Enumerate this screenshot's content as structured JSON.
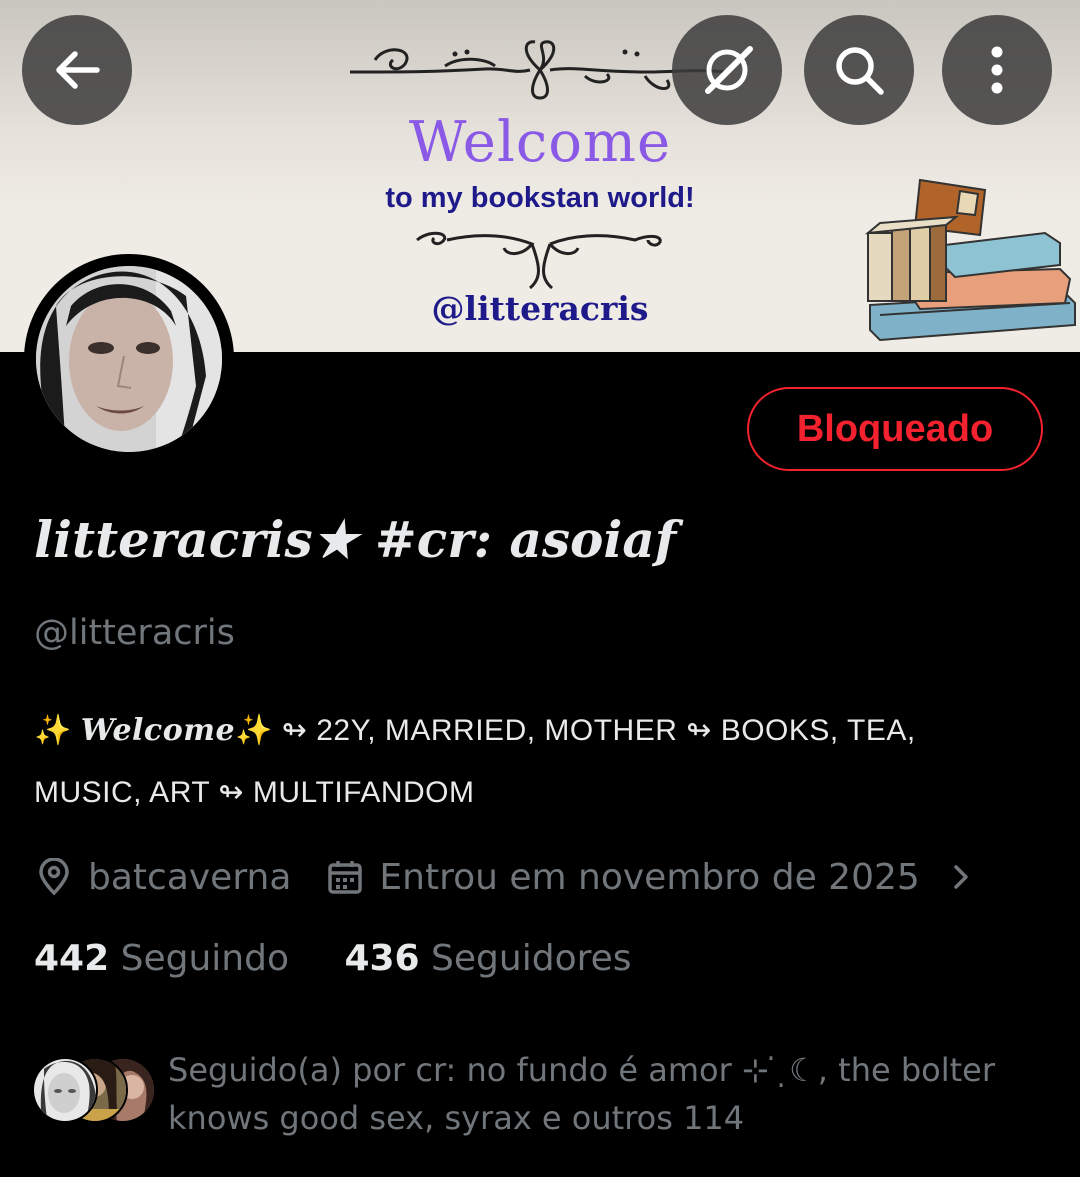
{
  "banner": {
    "welcome": "Welcome",
    "tagline": "to my bookstan world!",
    "handle": "@litteracris"
  },
  "toolbar": {
    "back_icon": "arrow-left-icon",
    "grok_icon": "grok-icon",
    "search_icon": "search-icon",
    "more_icon": "more-vertical-icon"
  },
  "profile": {
    "blocked_label": "Bloqueado",
    "display_name": "litteracris★ #cr: asoiaf",
    "handle": "@litteracris",
    "bio_line1_a": "✨",
    "bio_line1_welcome": "Welcome",
    "bio_line1_b": "✨ ↬ 22Y, MARRIED, MOTHER ↬ BOOKS, TEA,",
    "bio_line2": "MUSIC, ART ↬ MULTIFANDOM",
    "location": "batcaverna",
    "joined": "Entrou em novembro de 2025",
    "following_count": "442",
    "following_label": "Seguindo",
    "followers_count": "436",
    "followers_label": "Seguidores",
    "followed_by": "Seguido(a) por cr: no fundo é amor ⊹ ̇ ̣☾, the bolter knows good sex, syrax e outros 114"
  },
  "colors": {
    "accent_blocked": "#f4212e",
    "muted_text": "#71767b",
    "primary_text": "#e7e9ea",
    "banner_purple": "#8a5ae6",
    "banner_navy": "#1e1a8a"
  }
}
